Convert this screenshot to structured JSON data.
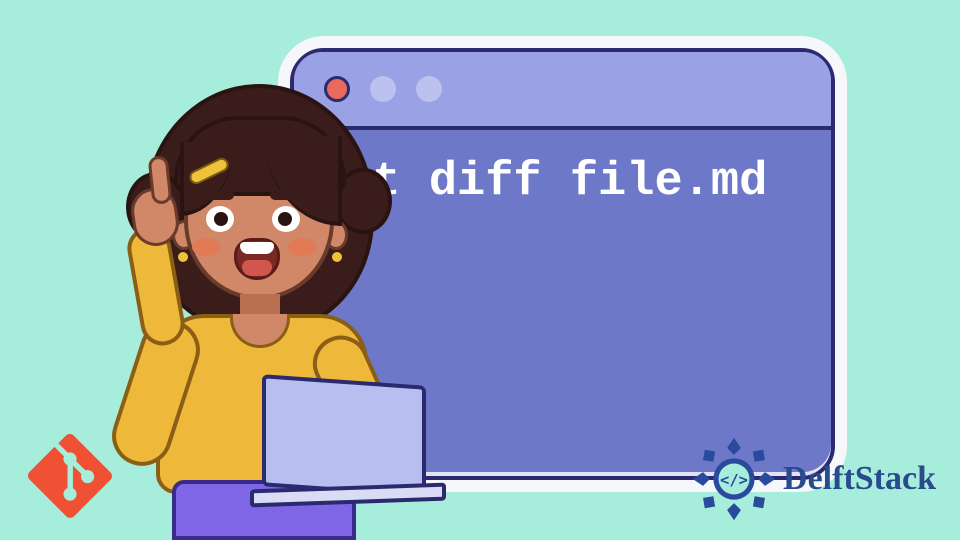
{
  "terminal": {
    "command": "git diff file.md",
    "dots": [
      "red",
      "light",
      "light"
    ]
  },
  "brand": {
    "name": "DelftStack"
  },
  "icons": {
    "git": "git-icon",
    "delft": "delft-icon"
  }
}
